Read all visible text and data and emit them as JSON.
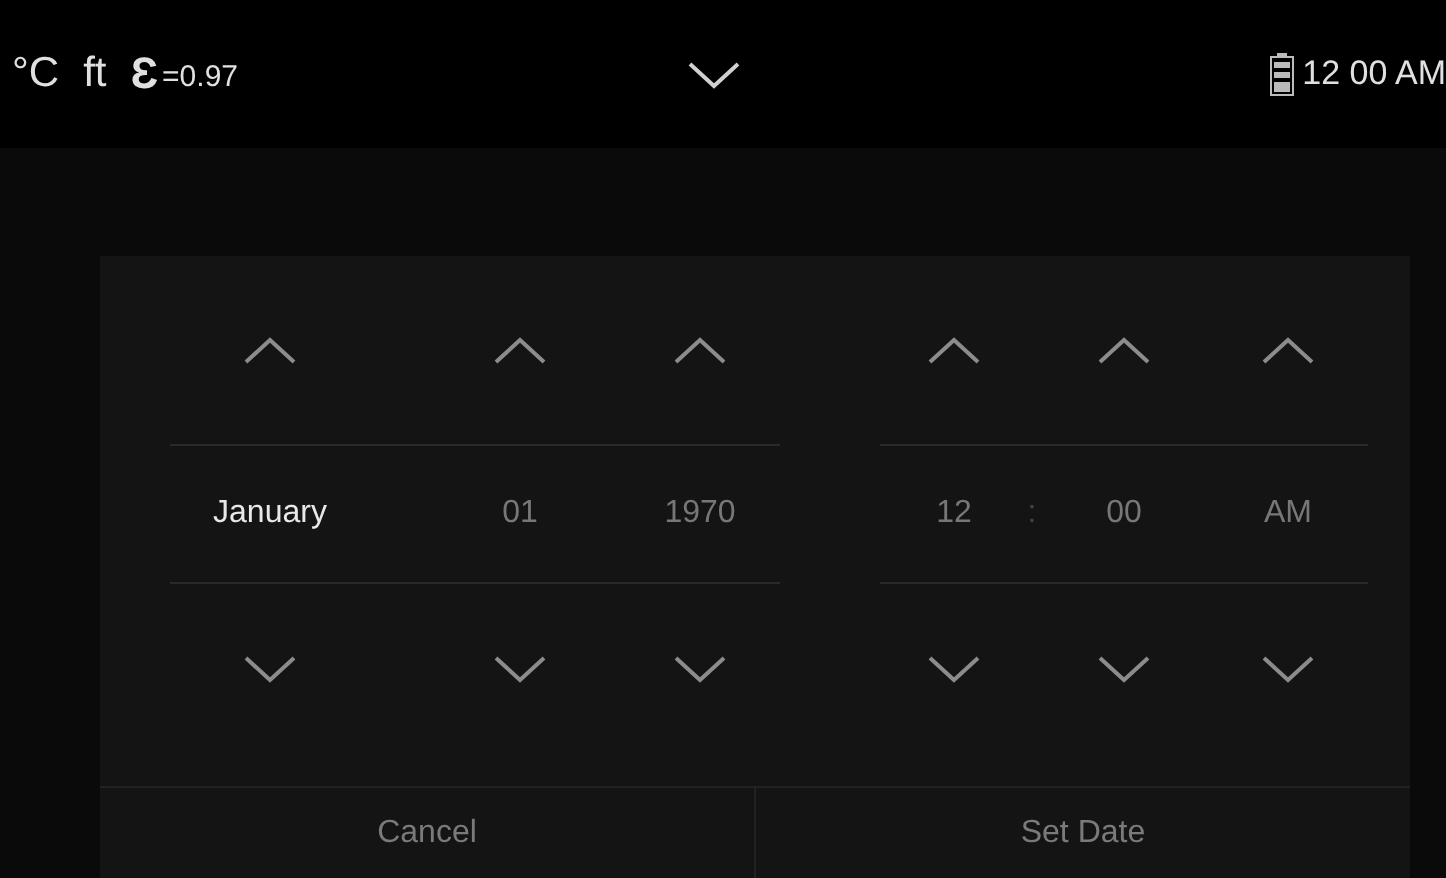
{
  "status_bar": {
    "temperature_unit": "°C",
    "distance_unit": "ft",
    "emissivity_symbol": "Ɛ",
    "emissivity": "=0.97",
    "time": "12 00 AM"
  },
  "picker": {
    "groups": [
      {
        "columns": [
          {
            "value": "January",
            "selected": true
          },
          {
            "value": "01",
            "selected": false
          },
          {
            "value": "1970",
            "selected": false
          }
        ]
      },
      {
        "separator": ":",
        "columns": [
          {
            "value": "12",
            "selected": false
          },
          {
            "value": "00",
            "selected": false
          },
          {
            "value": "AM",
            "selected": false
          }
        ]
      }
    ]
  },
  "buttons": [
    "Cancel",
    "Set Date"
  ]
}
